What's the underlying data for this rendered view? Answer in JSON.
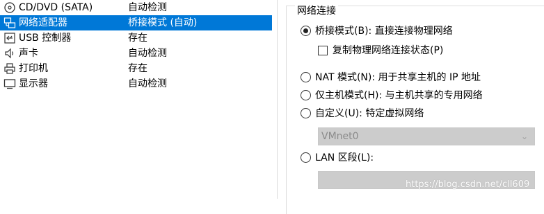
{
  "devices": [
    {
      "name": "CD/DVD (SATA)",
      "status": "自动检测",
      "icon": "cd-dvd-icon",
      "selected": false
    },
    {
      "name": "网络适配器",
      "status": "桥接模式 (自动)",
      "icon": "network-adapter-icon",
      "selected": true
    },
    {
      "name": "USB 控制器",
      "status": "存在",
      "icon": "usb-icon",
      "selected": false
    },
    {
      "name": "声卡",
      "status": "自动检测",
      "icon": "speaker-icon",
      "selected": false
    },
    {
      "name": "打印机",
      "status": "存在",
      "icon": "printer-icon",
      "selected": false
    },
    {
      "name": "显示器",
      "status": "自动检测",
      "icon": "monitor-icon",
      "selected": false
    }
  ],
  "network": {
    "group_title": "网络连接",
    "bridged": {
      "label": "桥接模式(B): 直接连接物理网络",
      "checked": true
    },
    "replicate": {
      "label": "复制物理网络连接状态(P)",
      "checked": false
    },
    "nat": {
      "label": "NAT 模式(N): 用于共享主机的 IP 地址",
      "checked": false
    },
    "host_only": {
      "label": "仅主机模式(H): 与主机共享的专用网络",
      "checked": false
    },
    "custom": {
      "label": "自定义(U): 特定虚拟网络",
      "checked": false
    },
    "vmnet_select": {
      "value": "VMnet0",
      "enabled": false
    },
    "lan": {
      "label": "LAN 区段(L):",
      "checked": false
    },
    "lan_select": {
      "value": "",
      "enabled": false
    }
  },
  "watermark": "https://blog.csdn.net/cll609",
  "colors": {
    "selection": "#0078d7",
    "disabled": "#cccccc"
  }
}
